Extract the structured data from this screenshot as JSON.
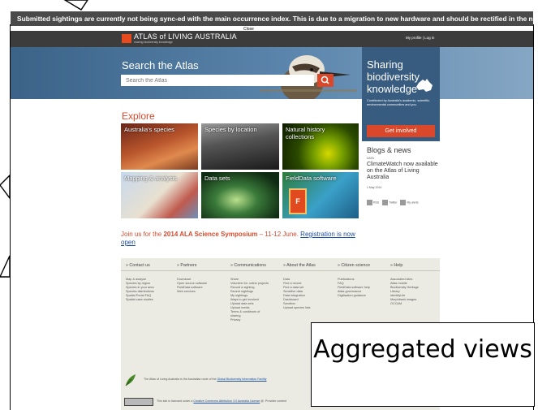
{
  "notice": {
    "text": "Submitted sightings are currently not being sync-ed with the main occurrence index. This is due to a migration to new hardware and should be rectified in the next few weeks",
    "close_label": "Close"
  },
  "header": {
    "logo_text": "ATLAS of LIVING AUSTRALIA",
    "logo_tagline": "sharing biodiversity knowledge",
    "profile_links": "My profile | Log in"
  },
  "search": {
    "title": "Search the Atlas",
    "placeholder": "Search the Atlas",
    "button_icon": "search-icon"
  },
  "share": {
    "title": "Sharing biodiversity knowledge",
    "description": "Contributed by Australia's academic, scientific, environmental communities and you.",
    "button_label": "Get involved"
  },
  "explore": {
    "title": "Explore",
    "tiles": [
      {
        "label": "Australia's species"
      },
      {
        "label": "Species by location"
      },
      {
        "label": "Natural history collections"
      },
      {
        "label": "Mapping & analysis"
      },
      {
        "label": "Data sets"
      },
      {
        "label": "FieldData software"
      }
    ]
  },
  "blog": {
    "title": "Blogs & news",
    "tag": "DATA",
    "headline": "ClimateWatch now available on the Atlas of Living Australia",
    "date": "1 May 2014",
    "social": [
      "RSS",
      "Twitter",
      "My alerts"
    ]
  },
  "symposium": {
    "prefix": "Join us for the ",
    "event": "2014 ALA Science Symposium",
    "suffix": " – 11-12 June. ",
    "link": "Registration is now open"
  },
  "footer": {
    "columns": [
      {
        "heading": "» Contact us",
        "items": [
          "Map & analyse",
          "Species by region",
          "Species in your area",
          "Species distributions",
          "Spatial Portal FAQ",
          "Spatial case studies"
        ]
      },
      {
        "heading": "» Partners",
        "items": [
          "Download",
          "Open source software",
          "FieldData software",
          "Web services"
        ]
      },
      {
        "heading": "» Communications",
        "items": [
          "Share",
          "Volunteer for online projects",
          "Record a sighting",
          "Recent sightings",
          "My sightings",
          "Ways to get involved",
          "Upload data sets",
          "Upload media",
          "Terms & conditions of",
          "sharing",
          "Privacy"
        ]
      },
      {
        "heading": "» About the Atlas",
        "items": [
          "Data",
          "Find a record",
          "Find a data set",
          "Sensitive data",
          "Data integration",
          "Dashboard",
          "Sandbox",
          "Upload species lists"
        ]
      },
      {
        "heading": "» Citizen science",
        "items": [
          "Publications",
          "FAQ",
          "FieldData software help",
          "Atlas governance",
          "Digitisation guidance"
        ]
      },
      {
        "heading": "» Help",
        "items": [
          "Associated sites",
          "Atlas mobile",
          "Biodiversity Heritage",
          "Library",
          "IdentifyLife",
          "Morphbank images",
          "OCCAM"
        ]
      }
    ],
    "ala_prefix": "The Atlas of Living Australia is the Australian node of the ",
    "ala_link": "Global Biodiversity Information Facility",
    "license_prefix": "This site is licensed under a ",
    "license_link": "Creative Commons Attribution 3.0 Australia License",
    "license_suffix": " @. Provider content"
  },
  "callout": {
    "text": "Aggregated views"
  }
}
